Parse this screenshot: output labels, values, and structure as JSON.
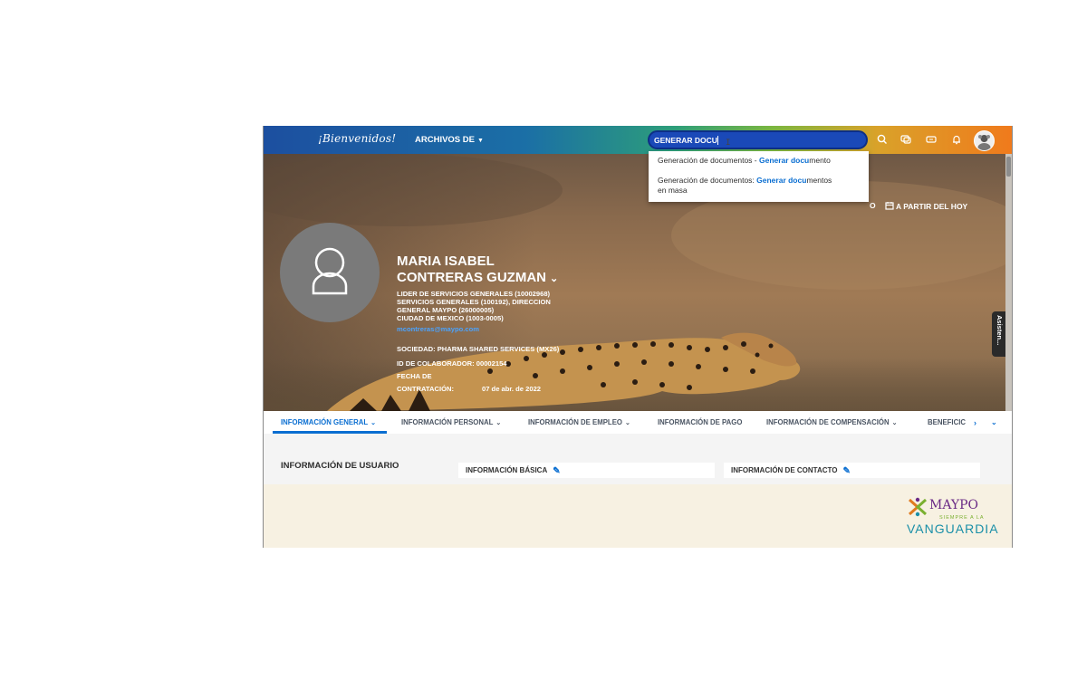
{
  "topbar": {
    "logo": "¡Bienvenidos!",
    "files_menu": "ARCHIVOS DE",
    "search_value": "GENERAR DOCU"
  },
  "search_suggestions": [
    {
      "prefix": "Generación de documentos - ",
      "match": "Generar docu",
      "suffix": "mento",
      "rest": ""
    },
    {
      "prefix": "Generación de documentos: ",
      "match": "Generar docu",
      "suffix": "mentos",
      "rest": "en masa"
    }
  ],
  "hero": {
    "hidden_char": "O",
    "as_of": "A PARTIR DEL HOY",
    "name_line1": "MARIA ISABEL",
    "name_line2": "CONTRERAS GUZMAN",
    "position_lines": [
      "LIDER DE SERVICIOS GENERALES (10002968)",
      "SERVICIOS GENERALES (100192), DIRECCION",
      "GENERAL MAYPO (26000005)",
      "CIUDAD DE MEXICO (1003-0005)"
    ],
    "email": "mcontreras@maypo.com",
    "company": "SOCIEDAD: PHARMA SHARED SERVICES (MX26)",
    "employee_id": "ID DE COLABORADOR: 00002154",
    "hire_label_1": "FECHA DE",
    "hire_label_2": "CONTRATACIÓN:",
    "hire_date": "07 de abr. de 2022",
    "side_tab": "Asisten..."
  },
  "tabs": [
    {
      "label": "INFORMACIÓN GENERAL",
      "chevron": true,
      "active": true
    },
    {
      "label": "INFORMACIÓN PERSONAL",
      "chevron": true
    },
    {
      "label": "INFORMACIÓN DE EMPLEO",
      "chevron": true
    },
    {
      "label": "INFORMACIÓN DE PAGO",
      "chevron": false
    },
    {
      "label": "INFORMACIÓN DE COMPENSACIÓN",
      "chevron": true
    },
    {
      "label": "BENEFICIC",
      "chevron": false
    }
  ],
  "content": {
    "user_info": "INFORMACIÓN DE USUARIO",
    "basic_info": "INFORMACIÓN BÁSICA",
    "contact_info": "INFORMACIÓN DE CONTACTO"
  },
  "footer": {
    "brand": "MAYPO",
    "tagline": "SIEMPRE A LA",
    "slogan": "VANGUARDIA"
  },
  "colors": {
    "accent": "#0a6ed1",
    "search_bg": "#1a49b8",
    "footer_bg": "#f7f1e2"
  },
  "icons": [
    "search-icon",
    "chat-icon",
    "notes-icon",
    "bell-icon",
    "calendar-icon",
    "pencil-icon",
    "chevron-down-icon",
    "chevron-right-icon",
    "user-icon"
  ]
}
